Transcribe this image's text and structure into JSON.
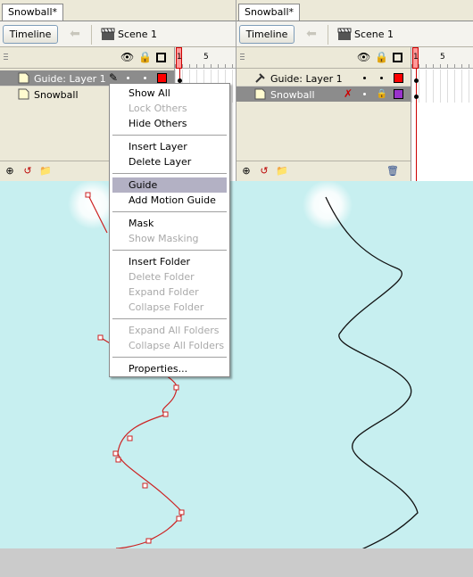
{
  "left": {
    "tab": "Snowball*",
    "timeline_button": "Timeline",
    "scene": "Scene 1",
    "frame_labels": [
      "1",
      "5"
    ],
    "layers": [
      {
        "name": "Guide: Layer 1",
        "selected": true,
        "color": "#ff0000"
      },
      {
        "name": "Snowball",
        "selected": false,
        "color": "#ff0000"
      }
    ]
  },
  "right": {
    "tab": "Snowball*",
    "timeline_button": "Timeline",
    "scene": "Scene 1",
    "frame_labels": [
      "1",
      "5"
    ],
    "layers": [
      {
        "name": "Guide: Layer 1",
        "selected": false,
        "color": "#ff0000"
      },
      {
        "name": "Snowball",
        "selected": true,
        "color": "#9933cc"
      }
    ]
  },
  "menu": {
    "show_all": "Show All",
    "lock_others": "Lock Others",
    "hide_others": "Hide Others",
    "insert_layer": "Insert Layer",
    "delete_layer": "Delete Layer",
    "guide": "Guide",
    "add_motion_guide": "Add Motion Guide",
    "mask": "Mask",
    "show_masking": "Show Masking",
    "insert_folder": "Insert Folder",
    "delete_folder": "Delete Folder",
    "expand_folder": "Expand Folder",
    "collapse_folder": "Collapse Folder",
    "expand_all_folders": "Expand All Folders",
    "collapse_all_folders": "Collapse All Folders",
    "properties": "Properties..."
  },
  "colors": {
    "stage": "#c7eff0",
    "guide_path_left": "#cc2222",
    "guide_path_right": "#000000",
    "menu_highlight": "#b3b1c4"
  }
}
